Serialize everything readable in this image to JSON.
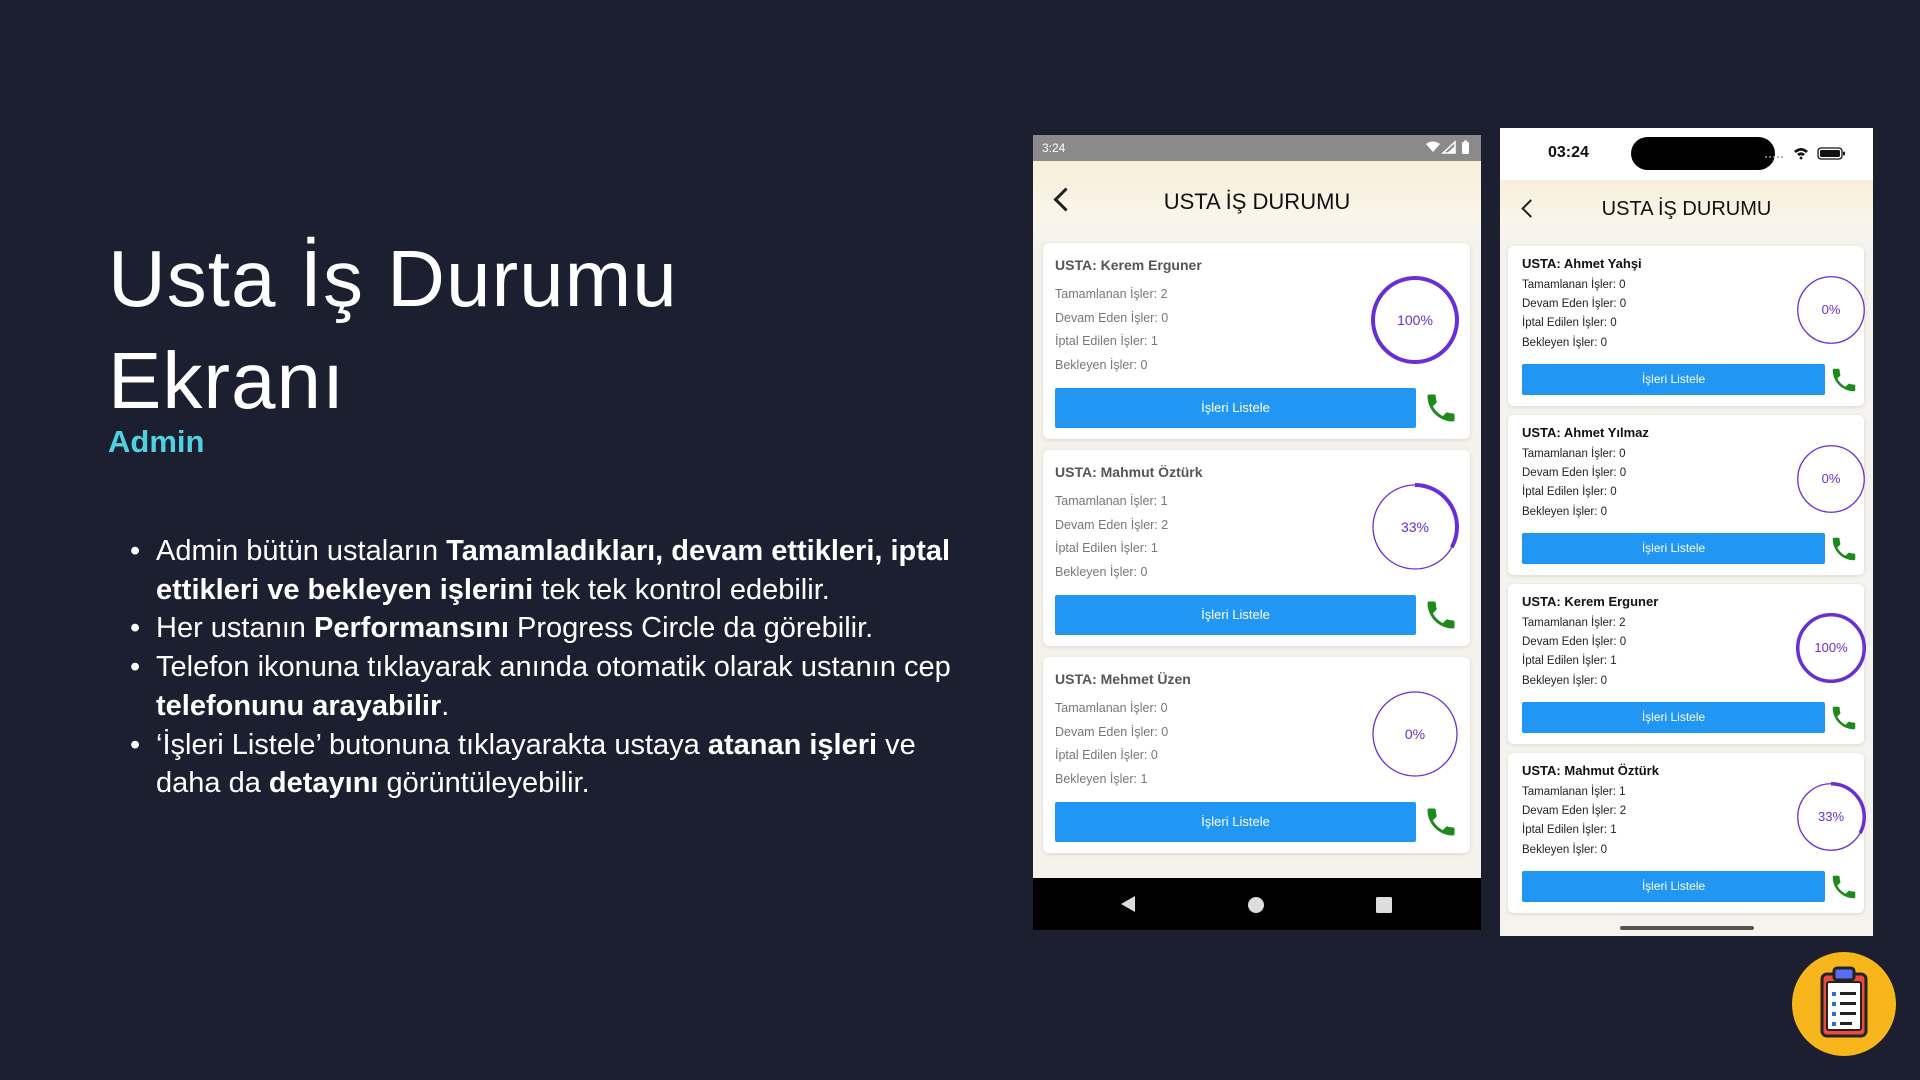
{
  "slide": {
    "title_line1": "Usta İş Durumu",
    "title_line2": "Ekranı",
    "subtitle": "Admin",
    "bullets": [
      {
        "parts": [
          {
            "t": "Admin bütün ustaların  ",
            "b": false
          },
          {
            "t": "Tamamladıkları, devam ettikleri, iptal ettikleri ve bekleyen işlerini",
            "b": true
          },
          {
            "t": " tek tek kontrol edebilir.",
            "b": false
          }
        ]
      },
      {
        "parts": [
          {
            "t": "Her ustanın ",
            "b": false
          },
          {
            "t": "Performansını",
            "b": true
          },
          {
            "t": " Progress Circle da görebilir.",
            "b": false
          }
        ]
      },
      {
        "parts": [
          {
            "t": "Telefon ikonuna tıklayarak anında otomatik olarak ustanın cep ",
            "b": false
          },
          {
            "t": "telefonunu arayabilir",
            "b": true
          },
          {
            "t": ".",
            "b": false
          }
        ]
      },
      {
        "parts": [
          {
            "t": "‘İşleri Listele’ butonuna tıklayarakta ustaya ",
            "b": false
          },
          {
            "t": "atanan işleri",
            "b": true
          },
          {
            "t": " ve daha da ",
            "b": false
          },
          {
            "t": "detayını",
            "b": true
          },
          {
            "t": " görüntüleyebilir.",
            "b": false
          }
        ]
      }
    ]
  },
  "colors": {
    "background": "#1b1f30",
    "accent": "#4fd1e1",
    "button": "#2196f3",
    "ring": "#6a2ed6",
    "phone_green": "#1e8a1e"
  },
  "android": {
    "time": "3:24",
    "screen_title": "USTA İŞ DURUMU",
    "cards": [
      {
        "name": "USTA: Kerem Erguner",
        "stats": [
          "Tamamlanan İşler: 2",
          "Devam Eden İşler: 0",
          "İptal Edilen İşler: 1",
          "Bekleyen İşler: 0"
        ],
        "percent_label": "100%",
        "progress": 1.0,
        "button": "İşleri Listele"
      },
      {
        "name": "USTA: Mahmut Öztürk",
        "stats": [
          "Tamamlanan İşler: 1",
          "Devam Eden İşler: 2",
          "İptal Edilen İşler: 1",
          "Bekleyen İşler: 0"
        ],
        "percent_label": "33%",
        "progress": 0.33,
        "button": "İşleri Listele"
      },
      {
        "name": "USTA: Mehmet Üzen",
        "stats": [
          "Tamamlanan İşler: 0",
          "Devam Eden İşler: 0",
          "İptal Edilen İşler: 0",
          "Bekleyen İşler: 1"
        ],
        "percent_label": "0%",
        "progress": 0.0,
        "button": "İşleri Listele"
      }
    ]
  },
  "ios": {
    "time": "03:24",
    "screen_title": "USTA İŞ DURUMU",
    "cards": [
      {
        "name": "USTA: Ahmet Yahşi",
        "stats": [
          "Tamamlanan İşler: 0",
          "Devam Eden İşler: 0",
          "İptal Edilen İşler: 0",
          "Bekleyen İşler: 0"
        ],
        "percent_label": "0%",
        "progress": 0.0,
        "button": "İşleri Listele"
      },
      {
        "name": "USTA: Ahmet Yılmaz",
        "stats": [
          "Tamamlanan İşler: 0",
          "Devam Eden İşler: 0",
          "İptal Edilen İşler: 0",
          "Bekleyen İşler: 0"
        ],
        "percent_label": "0%",
        "progress": 0.0,
        "button": "İşleri Listele"
      },
      {
        "name": "USTA: Kerem Erguner",
        "stats": [
          "Tamamlanan İşler: 2",
          "Devam Eden İşler: 0",
          "İptal Edilen İşler: 1",
          "Bekleyen İşler: 0"
        ],
        "percent_label": "100%",
        "progress": 1.0,
        "button": "İşleri Listele"
      },
      {
        "name": "USTA: Mahmut Öztürk",
        "stats": [
          "Tamamlanan İşler: 1",
          "Devam Eden İşler: 2",
          "İptal Edilen İşler: 1",
          "Bekleyen İşler: 0"
        ],
        "percent_label": "33%",
        "progress": 0.33,
        "button": "İşleri Listele"
      }
    ]
  },
  "icons": {
    "back": "chevron-left-icon",
    "call": "phone-icon",
    "logo": "clipboard-checklist-icon"
  }
}
